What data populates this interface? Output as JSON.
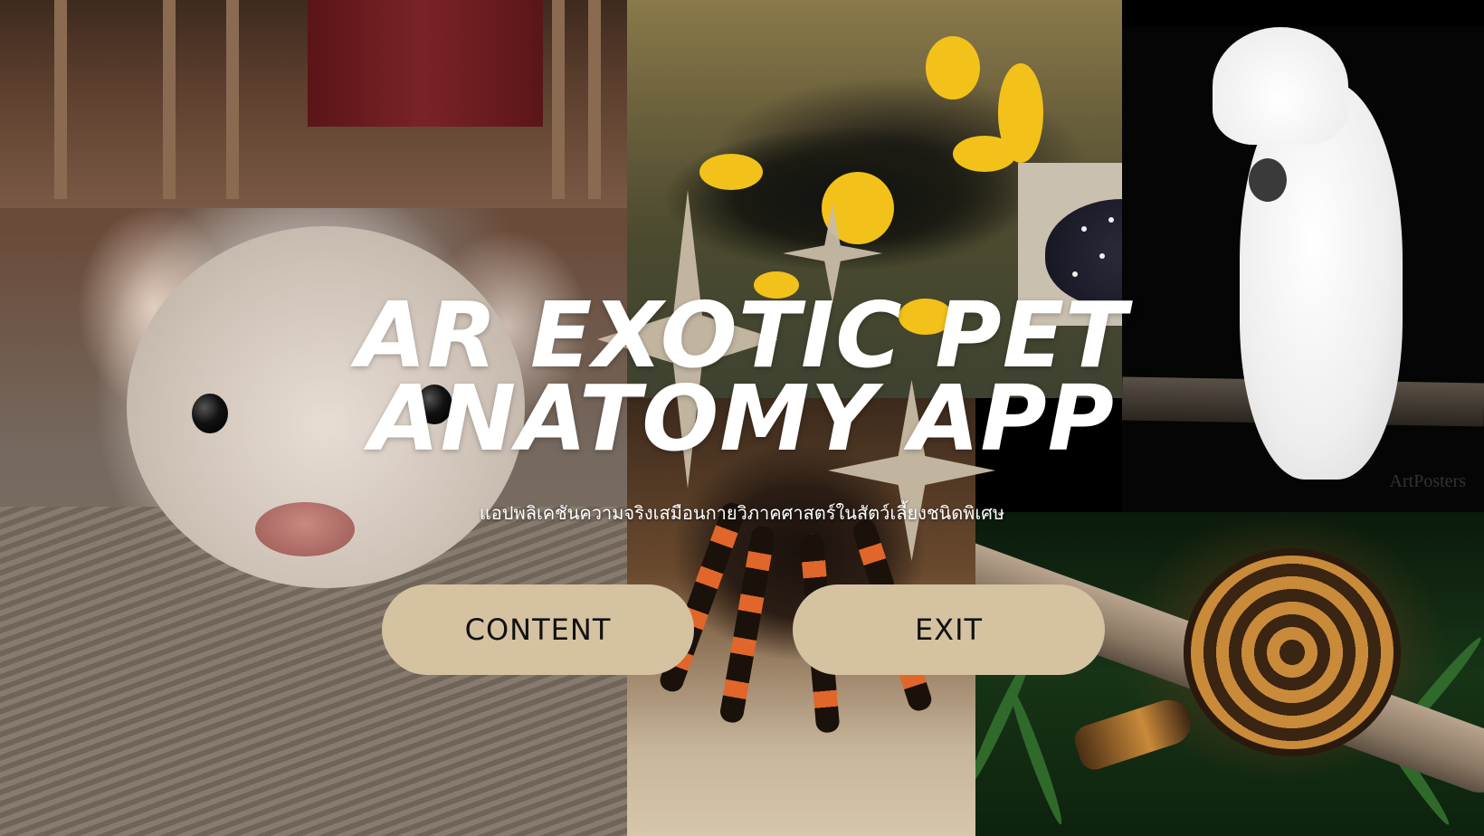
{
  "title": {
    "line1": "AR EXOTIC PET",
    "line2": "ANATOMY APP"
  },
  "subtitle": "แอปพลิเคชันความจริงเสมือนกายวิภาคศาสตร์ในสัตว์เลี้ยงชนิดพิเศษ",
  "buttons": {
    "content_label": "CONTENT",
    "exit_label": "EXIT"
  },
  "watermark": "ArtPosters",
  "photos": [
    "ferret",
    "salamander",
    "stingray",
    "cockatoo",
    "tarantula",
    "ball-python"
  ],
  "colors": {
    "button_fill": "#d5c2a0",
    "button_text": "#111111",
    "title_text": "#ffffff",
    "sparkle": "#c8bca6"
  }
}
